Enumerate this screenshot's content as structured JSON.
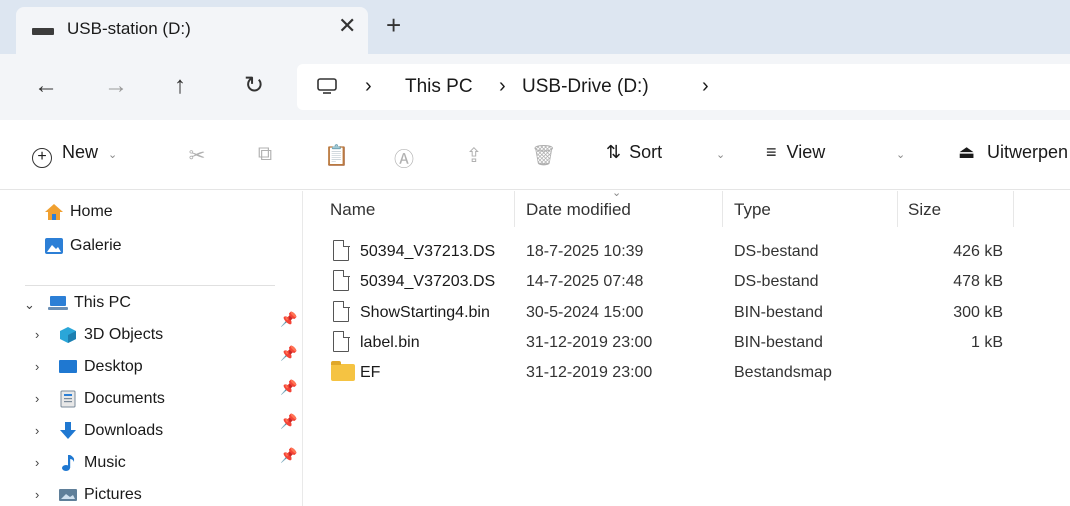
{
  "tab": {
    "title": "USB-station (D:)",
    "close": "✕",
    "new_tab": "+"
  },
  "nav": {
    "back": "←",
    "forward": "→",
    "up": "↑",
    "refresh": "↻"
  },
  "address": {
    "separator": "›",
    "crumbs": [
      "This PC",
      "USB-Drive (D:)"
    ]
  },
  "toolbar": {
    "new_label": "New",
    "sort_label": "Sort",
    "view_label": "View",
    "eject_label": "Uitwerpen"
  },
  "sidebar": {
    "quick": [
      {
        "label": "Home",
        "icon": "home-icon"
      },
      {
        "label": "Galerie",
        "icon": "gallery-icon"
      }
    ],
    "this_pc": {
      "label": "This PC",
      "icon": "computer-icon"
    },
    "children": [
      {
        "label": "3D Objects",
        "icon": "cube-icon",
        "pinned": true
      },
      {
        "label": "Desktop",
        "icon": "desktop-icon",
        "pinned": true
      },
      {
        "label": "Documents",
        "icon": "document-icon",
        "pinned": true
      },
      {
        "label": "Downloads",
        "icon": "download-icon",
        "pinned": true
      },
      {
        "label": "Music",
        "icon": "music-icon",
        "pinned": true
      },
      {
        "label": "Pictures",
        "icon": "pictures-icon",
        "pinned": false
      }
    ]
  },
  "columns": {
    "name": "Name",
    "date": "Date modified",
    "type": "Type",
    "size": "Size"
  },
  "files": [
    {
      "name": "50394_V37213.DS",
      "date": "18-7-2025 10:39",
      "type": "DS-bestand",
      "size": "426 kB",
      "kind": "file"
    },
    {
      "name": "50394_V37203.DS",
      "date": "14-7-2025 07:48",
      "type": "DS-bestand",
      "size": "478 kB",
      "kind": "file"
    },
    {
      "name": "ShowStarting4.bin",
      "date": "30-5-2024 15:00",
      "type": "BIN-bestand",
      "size": "300 kB",
      "kind": "file"
    },
    {
      "name": "label.bin",
      "date": "31-12-2019 23:00",
      "type": "BIN-bestand",
      "size": "1 kB",
      "kind": "file"
    },
    {
      "name": "EF",
      "date": "31-12-2019 23:00",
      "type": "Bestandsmap",
      "size": "",
      "kind": "folder"
    }
  ]
}
